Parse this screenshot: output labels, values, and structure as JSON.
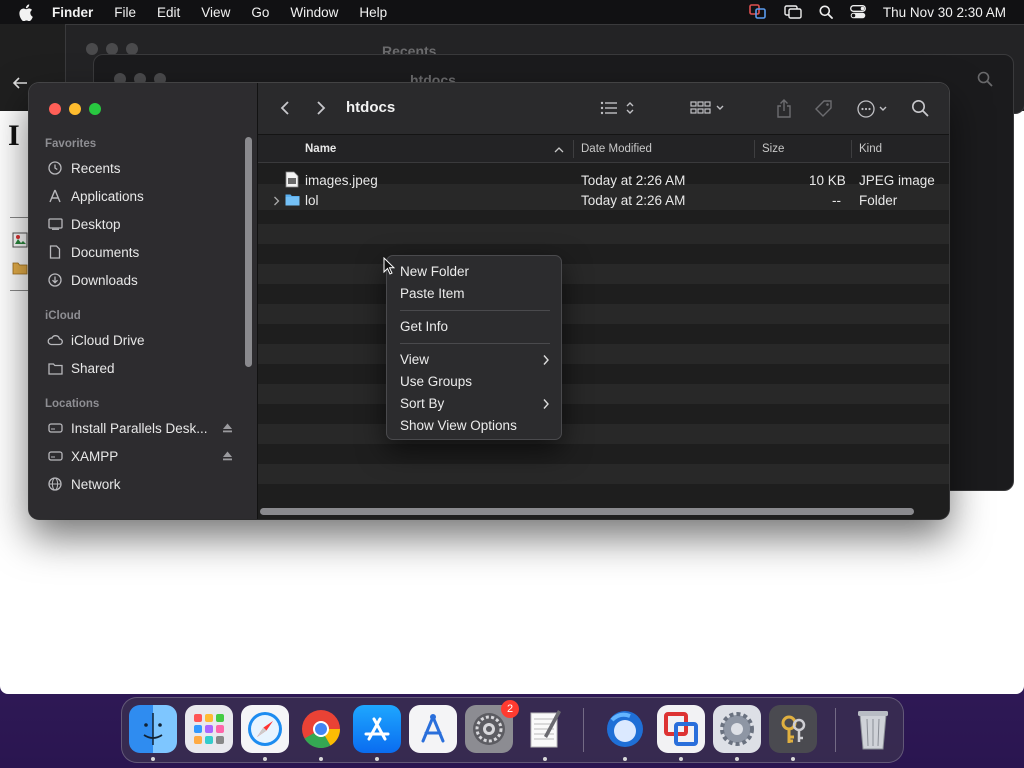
{
  "menubar": {
    "app_name": "Finder",
    "menus": [
      "File",
      "Edit",
      "View",
      "Go",
      "Window",
      "Help"
    ],
    "clock": "Thu Nov 30  2:30 AM"
  },
  "background_windows": {
    "ghost_titles": [
      "Recents",
      "htdocs"
    ]
  },
  "finder": {
    "title": "htdocs",
    "sidebar": {
      "favorites_header": "Favorites",
      "favorites": [
        {
          "label": "Recents",
          "icon": "clock-icon"
        },
        {
          "label": "Applications",
          "icon": "applications-icon"
        },
        {
          "label": "Desktop",
          "icon": "desktop-icon"
        },
        {
          "label": "Documents",
          "icon": "document-icon"
        },
        {
          "label": "Downloads",
          "icon": "download-icon"
        }
      ],
      "icloud_header": "iCloud",
      "icloud": [
        {
          "label": "iCloud Drive",
          "icon": "cloud-icon"
        },
        {
          "label": "Shared",
          "icon": "shared-folder-icon"
        }
      ],
      "locations_header": "Locations",
      "locations": [
        {
          "label": "Install Parallels Desk...",
          "icon": "drive-icon",
          "ejectable": true
        },
        {
          "label": "XAMPP",
          "icon": "drive-icon",
          "ejectable": true
        },
        {
          "label": "Network",
          "icon": "network-icon",
          "ejectable": false
        }
      ]
    },
    "columns": {
      "name": "Name",
      "date_modified": "Date Modified",
      "size": "Size",
      "kind": "Kind"
    },
    "files": [
      {
        "name": "images.jpeg",
        "date": "Today at 2:26 AM",
        "size": "10 KB",
        "kind": "JPEG image",
        "icon": "image-file-icon"
      },
      {
        "name": "lol",
        "date": "Today at 2:26 AM",
        "size": "--",
        "kind": "Folder",
        "icon": "folder-icon"
      }
    ]
  },
  "context_menu": {
    "items": [
      {
        "label": "New Folder"
      },
      {
        "label": "Paste Item"
      },
      {
        "label": "Get Info"
      },
      {
        "label": "View",
        "submenu": true
      },
      {
        "label": "Use Groups"
      },
      {
        "label": "Sort By",
        "submenu": true
      },
      {
        "label": "Show View Options"
      }
    ]
  },
  "dock": {
    "apps": [
      "finder-icon",
      "launchpad-icon",
      "safari-icon",
      "chrome-icon",
      "app-store-icon",
      "xcode-instruments-icon",
      "system-settings-icon",
      "textedit-icon",
      "thunderbird-icon",
      "parallels-icon",
      "system-preferences-icon",
      "keychain-icon",
      "trash-icon"
    ],
    "settings_badge": "2"
  },
  "colors": {
    "close": "#ff5f57",
    "minimize": "#febc2e",
    "maximize": "#28c840",
    "folder_blue": "#5ab0f0",
    "badge_red": "#ff3b30"
  }
}
